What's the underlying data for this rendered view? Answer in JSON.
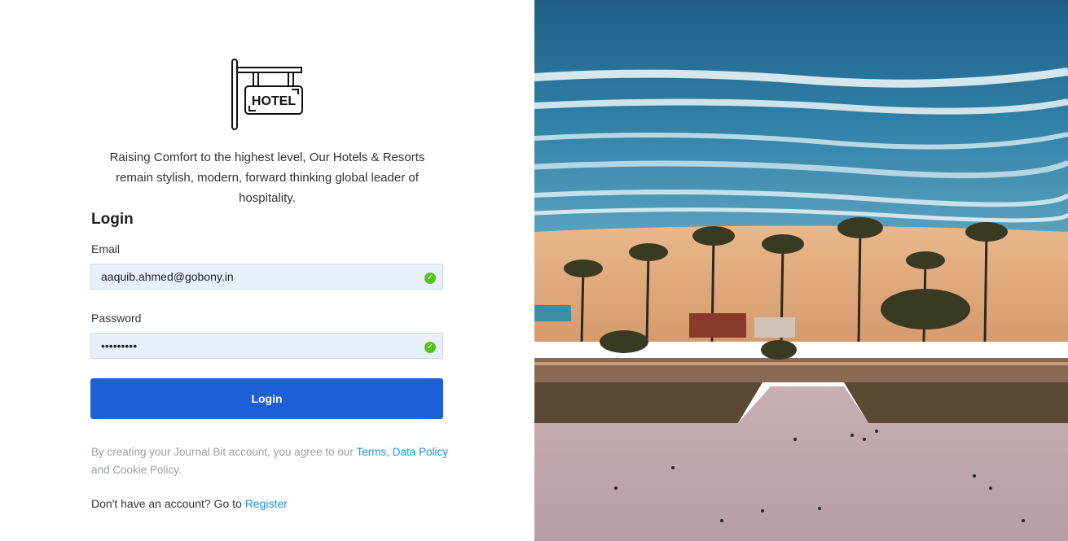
{
  "logo": {
    "text": "HOTEL",
    "icon": "hotel-sign-icon"
  },
  "tagline": "Raising Comfort to the highest level, Our Hotels & Resorts remain stylish, modern, forward thinking global leader of hospitality.",
  "login": {
    "title": "Login",
    "email_label": "Email",
    "email_value": "aaquib.ahmed@gobony.in",
    "password_label": "Password",
    "password_value": "•••••••••",
    "button_label": "Login"
  },
  "terms": {
    "prefix": "By creating your Journal Bit account, you agree to our ",
    "terms_link": "Terms",
    "sep": ", ",
    "data_policy_link": "Data Policy",
    "suffix": " and Cookie Policy."
  },
  "register": {
    "prefix": "Don't have an account? Go to ",
    "link": "Register"
  },
  "colors": {
    "primary": "#1c5fd8",
    "link": "#1890ff",
    "valid": "#52c41a",
    "input_bg": "#e8f0fe"
  },
  "hero_image": "beach-aerial-photo"
}
